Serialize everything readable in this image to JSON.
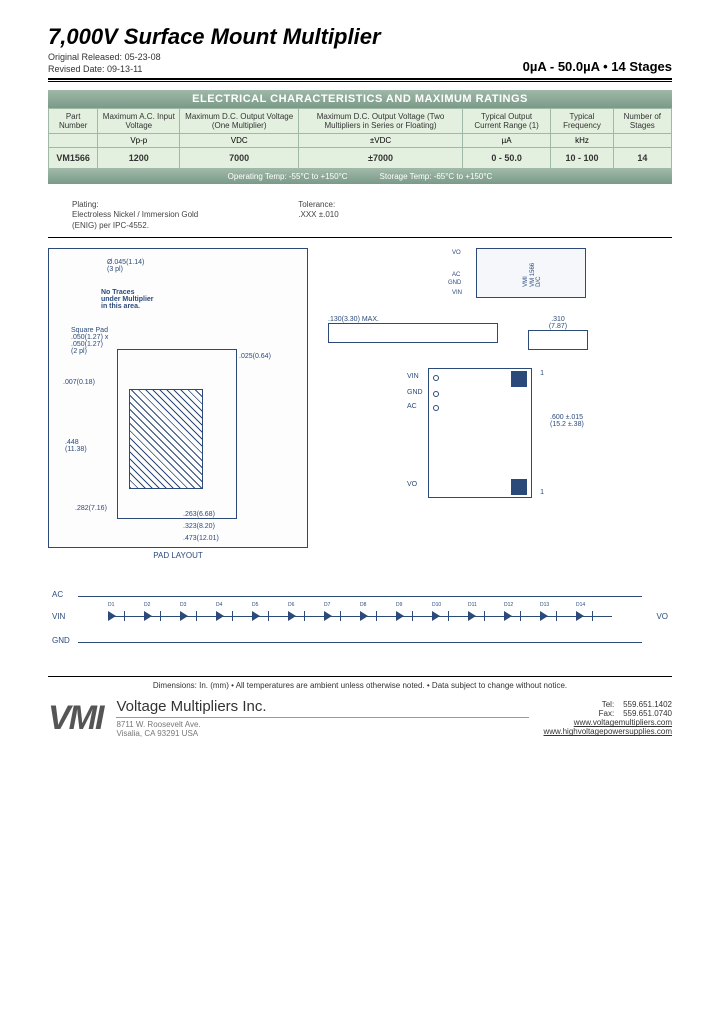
{
  "header": {
    "title": "7,000V Surface Mount Multiplier",
    "subtitle": "0µA - 50.0µA • 14 Stages",
    "released_label": "Original Released:",
    "released_date": "05-23-08",
    "revised_label": "Revised Date:",
    "revised_date": "09-13-11"
  },
  "table": {
    "section_title": "ELECTRICAL CHARACTERISTICS AND MAXIMUM RATINGS",
    "columns": [
      "Part Number",
      "Maximum A.C. Input Voltage",
      "Maximum D.C. Output Voltage (One Multiplier)",
      "Maximum D.C. Output Voltage (Two Multipliers in Series or Floating)",
      "Typical Output Current Range (1)",
      "Typical Frequency",
      "Number of Stages"
    ],
    "units": [
      "",
      "Vp-p",
      "VDC",
      "±VDC",
      "µA",
      "kHz",
      ""
    ],
    "row": [
      "VM1566",
      "1200",
      "7000",
      "±7000",
      "0 - 50.0",
      "10 - 100",
      "14"
    ],
    "temp_op": "Operating Temp:  -55°C to  +150°C",
    "temp_st": "Storage Temp:  -65°C to  +150°C"
  },
  "notes": {
    "plating_label": "Plating:",
    "plating_text1": "Electroless Nickel / Immersion Gold",
    "plating_text2": "(ENIG) per IPC-4552.",
    "tol_label": "Tolerance:",
    "tol_text": ".XXX  ±.010"
  },
  "padlayout": {
    "caption": "PAD LAYOUT",
    "diam": "Ø.045(1.14)",
    "diam_ct": "(3 pl)",
    "notrace1": "No Traces",
    "notrace2": "under Multiplier",
    "notrace3": "in this area.",
    "sq_label": "Square Pad",
    "sq_dim1": ".050(1.27) x",
    "sq_dim2": ".050(1.27)",
    "sq_ct": "(2 pl)",
    "d007": ".007(0.18)",
    "d025": ".025(0.64)",
    "d448": ".448",
    "d448mm": "(11.38)",
    "d282": ".282(7.16)",
    "d263": ".263(6.68)",
    "d323": ".323(8.20)",
    "d473": ".473(12.01)"
  },
  "sideview": {
    "height": ".130(3.30) MAX.",
    "width": ".310",
    "width_mm": "(7.87)"
  },
  "topbox": {
    "pin_vo": "VO",
    "pin_ac": "AC",
    "pin_gnd": "GND",
    "pin_vin": "VIN",
    "mfr": "VMI",
    "part": "VM 1566",
    "dc": "D/C"
  },
  "bottomdim": {
    "vin": "VIN",
    "gnd": "GND",
    "ac": "AC",
    "vo": "VO",
    "num1": "1",
    "dim": ".600 ±.015",
    "dim_mm": "(15.2 ±.38)"
  },
  "schematic": {
    "ac": "AC",
    "vin": "VIN",
    "gnd": "GND",
    "vo": "VO",
    "diodes": [
      "D1",
      "D2",
      "D3",
      "D4",
      "D5",
      "D6",
      "D7",
      "D8",
      "D9",
      "D10",
      "D11",
      "D12",
      "D13",
      "D14"
    ]
  },
  "footer": {
    "dim_note": "Dimensions:  In. (mm)   •   All temperatures are ambient unless otherwise noted.   •   Data subject to change without notice.",
    "company": "Voltage Multipliers Inc.",
    "addr1": "8711 W. Roosevelt Ave.",
    "addr2": "Visalia, CA  93291  USA",
    "tel_label": "Tel:",
    "tel": "559.651.1402",
    "fax_label": "Fax:",
    "fax": "559.651.0740",
    "url1": "www.voltagemultipliers.com",
    "url2": "www.highvoltagepowersupplies.com",
    "logo": "VMI"
  }
}
